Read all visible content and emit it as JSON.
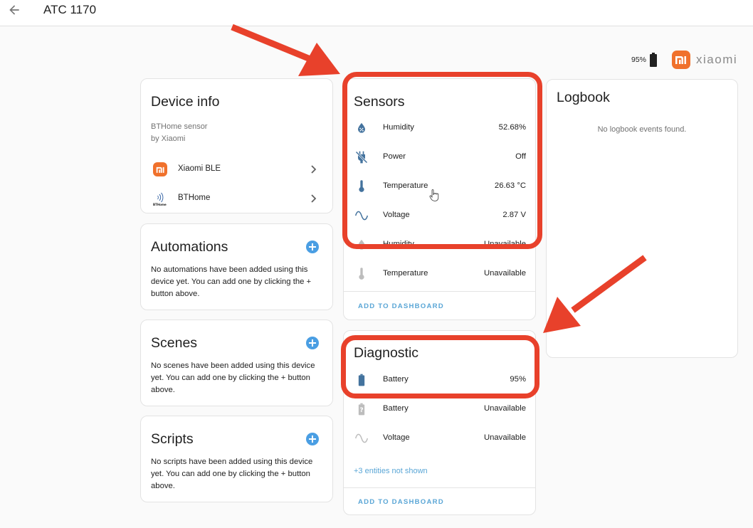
{
  "header": {
    "title": "ATC 1170",
    "back_icon": "arrow-left-icon"
  },
  "brand": {
    "battery_percent": "95%",
    "battery_icon": "battery-icon",
    "logo_icon": "xiaomi-mi-logo",
    "name": "xiaomi"
  },
  "device_info": {
    "title": "Device info",
    "model": "BTHome sensor",
    "manufacturer": "by Xiaomi",
    "integrations": [
      {
        "label": "Xiaomi BLE",
        "icon": "xiaomi-mi-logo"
      },
      {
        "label": "BTHome",
        "icon": "bthome-logo"
      }
    ]
  },
  "automations": {
    "title": "Automations",
    "empty_text": "No automations have been added using this device yet. You can add one by clicking the + button above."
  },
  "scenes": {
    "title": "Scenes",
    "empty_text": "No scenes have been added using this device yet. You can add one by clicking the + button above."
  },
  "scripts": {
    "title": "Scripts",
    "empty_text": "No scripts have been added using this device yet. You can add one by clicking the + button above."
  },
  "sensors": {
    "title": "Sensors",
    "entities": [
      {
        "name": "Humidity",
        "value": "52.68%",
        "icon": "water-percent-icon",
        "state": "available"
      },
      {
        "name": "Power",
        "value": "Off",
        "icon": "power-plug-off-icon",
        "state": "available"
      },
      {
        "name": "Temperature",
        "value": "26.63 °C",
        "icon": "thermometer-icon",
        "state": "available"
      },
      {
        "name": "Voltage",
        "value": "2.87 V",
        "icon": "sine-wave-icon",
        "state": "available"
      },
      {
        "name": "Humidity",
        "value": "Unavailable",
        "icon": "water-percent-icon",
        "state": "unavailable"
      },
      {
        "name": "Temperature",
        "value": "Unavailable",
        "icon": "thermometer-icon",
        "state": "unavailable"
      }
    ],
    "add_to_dashboard": "ADD TO DASHBOARD"
  },
  "diagnostic": {
    "title": "Diagnostic",
    "entities": [
      {
        "name": "Battery",
        "value": "95%",
        "icon": "battery-icon",
        "state": "available"
      },
      {
        "name": "Battery",
        "value": "Unavailable",
        "icon": "battery-unknown-icon",
        "state": "unavailable"
      },
      {
        "name": "Voltage",
        "value": "Unavailable",
        "icon": "sine-wave-icon",
        "state": "unavailable"
      }
    ],
    "hidden_entities": "+3 entities not shown",
    "add_to_dashboard": "ADD TO DASHBOARD"
  },
  "logbook": {
    "title": "Logbook",
    "empty_text": "No logbook events found."
  },
  "colors": {
    "accent": "#4a9ee3",
    "link": "#5aa6d6",
    "icon_active": "#44739e",
    "icon_unavailable": "#bdbdbd",
    "annotation": "#e8412b",
    "xiaomi_orange": "#f0712c"
  }
}
